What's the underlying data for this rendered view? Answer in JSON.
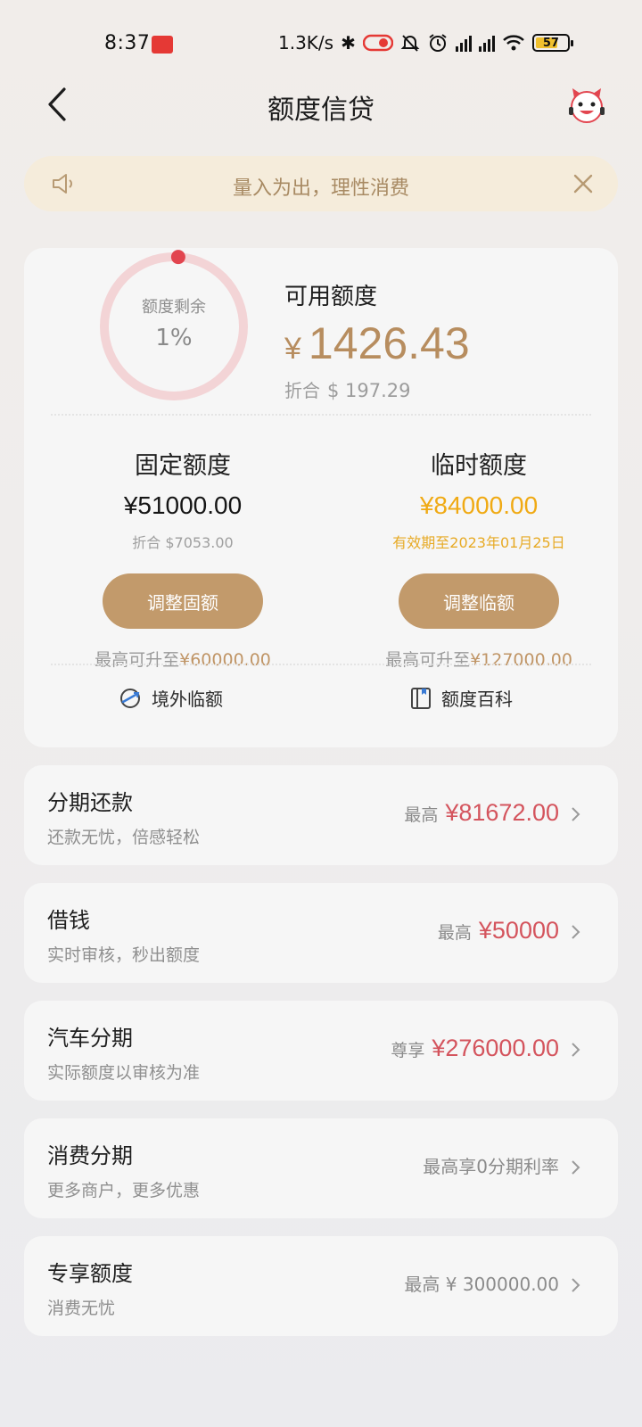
{
  "status_bar": {
    "time": "8:37",
    "speed": "1.3K/s",
    "battery": "57",
    "icons": [
      "app-notification-icon",
      "bluetooth-icon",
      "toggle-icon",
      "mute-icon",
      "alarm-icon",
      "signal-hd-1-icon",
      "signal-hd-2-icon",
      "wifi-icon",
      "battery-icon"
    ]
  },
  "header": {
    "title": "额度信贷",
    "back_icon": "chevron-left-icon",
    "mascot_icon": "mascot-icon"
  },
  "notice": {
    "text": "量入为出，理性消费",
    "icon": "speaker-icon",
    "close_icon": "close-icon"
  },
  "credit": {
    "ring_label": "额度剩余",
    "ring_percent_text": "1%",
    "ring_fraction": 0.01,
    "available_label": "可用额度",
    "available_currency": "¥",
    "available_amount": "1426.43",
    "usd_label": "折合",
    "usd_amount": "$ 197.29",
    "fixed": {
      "title": "固定额度",
      "amount": "¥51000.00",
      "sub": "折合 $7053.00",
      "button": "调整固额",
      "max_prefix": "最高可升至",
      "max_value": "¥60000.00"
    },
    "temp": {
      "title": "临时额度",
      "amount": "¥84000.00",
      "sub": "有效期至2023年01月25日",
      "button": "调整临额",
      "max_prefix": "最高可升至",
      "max_value": "¥127000.00"
    },
    "shortcuts": [
      {
        "label": "境外临额",
        "icon": "globe-plane-icon"
      },
      {
        "label": "额度百科",
        "icon": "book-icon"
      }
    ]
  },
  "services": [
    {
      "title": "分期还款",
      "subtitle": "还款无忧，倍感轻松",
      "prefix": "最高",
      "value": "¥81672.00",
      "value_style": "red"
    },
    {
      "title": "借钱",
      "subtitle": "实时审核，秒出额度",
      "prefix": "最高",
      "value": "¥50000",
      "value_style": "red"
    },
    {
      "title": "汽车分期",
      "subtitle": "实际额度以审核为准",
      "prefix": "尊享",
      "value": "¥276000.00",
      "value_style": "red"
    },
    {
      "title": "消费分期",
      "subtitle": "更多商户，更多优惠",
      "prefix": "",
      "value": "最高享0分期利率",
      "value_style": "grey"
    },
    {
      "title": "专享额度",
      "subtitle": "消费无忧",
      "prefix": "",
      "value": "最高 ¥ 300000.00",
      "value_style": "grey"
    }
  ],
  "colors": {
    "accent_gold": "#c29a6b",
    "amount_gold": "#b78d5f",
    "temp_amount": "#f0aa14",
    "service_red": "#d4545d",
    "ring_track": "#f3d4d6",
    "ring_dot": "#e2454f"
  }
}
